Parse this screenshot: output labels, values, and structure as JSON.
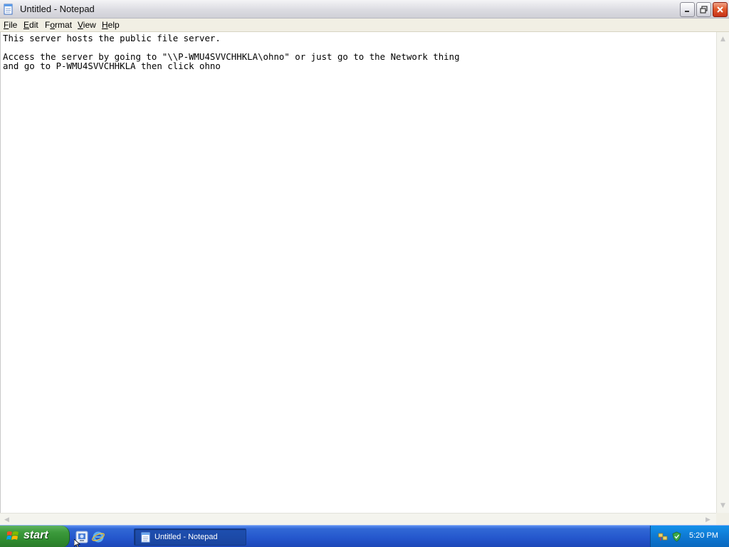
{
  "window": {
    "title": "Untitled - Notepad",
    "minimize_icon": "minimize-icon",
    "maximize_icon": "restore-icon",
    "close_icon": "close-icon"
  },
  "menu": {
    "items": [
      {
        "label": "File",
        "accel": "F",
        "rest": "ile"
      },
      {
        "label": "Edit",
        "accel": "E",
        "rest": "dit"
      },
      {
        "label": "Format",
        "pre": "F",
        "accel": "o",
        "rest": "rmat"
      },
      {
        "label": "View",
        "accel": "V",
        "rest": "iew"
      },
      {
        "label": "Help",
        "accel": "H",
        "rest": "elp"
      }
    ]
  },
  "document": {
    "text": "This server hosts the public file server.\n\nAccess the server by going to \"\\\\P-WMU4SVVCHHKLA\\ohno\" or just go to the Network thing\nand go to P-WMU4SVVCHHKLA then click ohno"
  },
  "taskbar": {
    "start_label": "start",
    "quick_launch": [
      "show-desktop-icon",
      "internet-explorer-icon"
    ],
    "task_button_label": "Untitled - Notepad",
    "tray_icons": [
      "network-icon",
      "security-icon"
    ],
    "clock": "5:20 PM"
  },
  "colors": {
    "taskbar_blue": "#2456cc",
    "start_green": "#3c9a3c",
    "tray_blue": "#0e78d3",
    "close_red": "#e05a2c"
  }
}
